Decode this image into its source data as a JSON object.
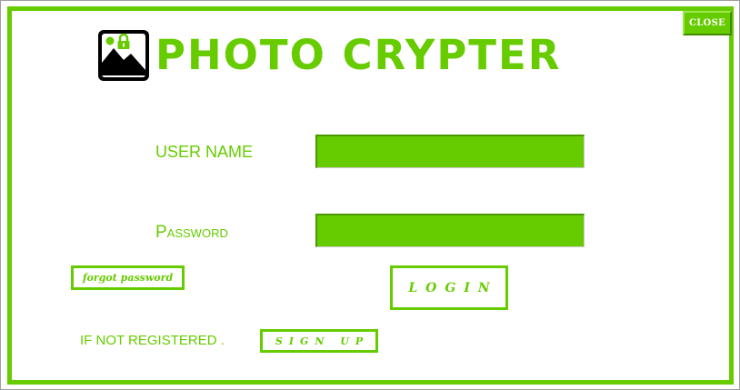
{
  "window": {
    "close_label": "CLOSE"
  },
  "header": {
    "title": "PHOTO CRYPTER",
    "logo_icon": "image-lock-icon"
  },
  "login_form": {
    "username_label": "USER NAME",
    "username_value": "",
    "password_label": "Password",
    "password_value": "",
    "forgot_label": "forgot password",
    "login_label": "LOGIN",
    "not_registered_label": "IF NOT REGISTERED .",
    "signup_label": "SIGN UP"
  },
  "colors": {
    "accent": "#66cc00",
    "background": "#ffffff",
    "logo": "#000000"
  }
}
